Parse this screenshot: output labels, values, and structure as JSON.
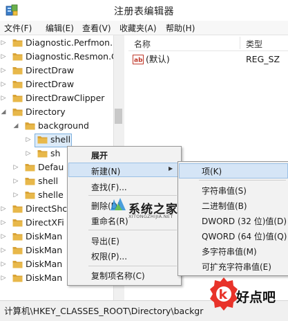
{
  "window": {
    "title": "注册表编辑器"
  },
  "menu": [
    "文件(F)",
    "编辑(E)",
    "查看(V)",
    "收藏夹(A)",
    "帮助(H)"
  ],
  "tree": [
    {
      "label": "Diagnostic.Perfmon.",
      "expanded": false
    },
    {
      "label": "Diagnostic.Resmon.C",
      "expanded": false
    },
    {
      "label": "DirectDraw",
      "expanded": false
    },
    {
      "label": "DirectDraw",
      "expanded": false
    },
    {
      "label": "DirectDrawClipper",
      "expanded": false
    },
    {
      "label": "Directory",
      "expanded": true
    },
    {
      "label": "background",
      "expanded": true
    },
    {
      "label": "shell",
      "expanded": false,
      "selected": true
    },
    {
      "label": "sh",
      "expanded": false
    },
    {
      "label": "Defau",
      "expanded": false
    },
    {
      "label": "shell",
      "expanded": false
    },
    {
      "label": "shelle",
      "expanded": false
    },
    {
      "label": "DirectShc",
      "expanded": false
    },
    {
      "label": "DirectXFi",
      "expanded": false
    },
    {
      "label": "DiskMan",
      "expanded": false
    },
    {
      "label": "DiskMan",
      "expanded": false
    },
    {
      "label": "DiskMan",
      "expanded": false
    },
    {
      "label": "DiskMan",
      "expanded": false
    }
  ],
  "list": {
    "col_name": "名称",
    "col_type": "类型",
    "rows": [
      {
        "name": "(默认)",
        "type": "REG_SZ",
        "icon": "ab-icon"
      }
    ]
  },
  "context_menu": {
    "items": [
      "展开",
      "新建(N)",
      "查找(F)...",
      "删除(D)",
      "重命名(R)",
      "导出(E)",
      "权限(P)...",
      "复制项名称(C)"
    ],
    "highlighted": "新建(N)"
  },
  "submenu": {
    "items": [
      "项(K)",
      "字符串值(S)",
      "二进制值(B)",
      "DWORD (32 位)值(D)",
      "QWORD (64 位)值(Q)",
      "多字符串值(M)",
      "可扩充字符串值(E)"
    ],
    "highlighted": "项(K)"
  },
  "statusbar": {
    "path": "计算机\\HKEY_CLASSES_ROOT\\Directory\\backgr"
  },
  "watermark": {
    "name": "系统之家",
    "url": "XITONGZHIJIA.NET"
  },
  "logo2": {
    "text": "好点吧"
  },
  "colors": {
    "folder": "#e8b84a",
    "highlight": "#d5e5f6",
    "logo_red": "#e8332a"
  }
}
